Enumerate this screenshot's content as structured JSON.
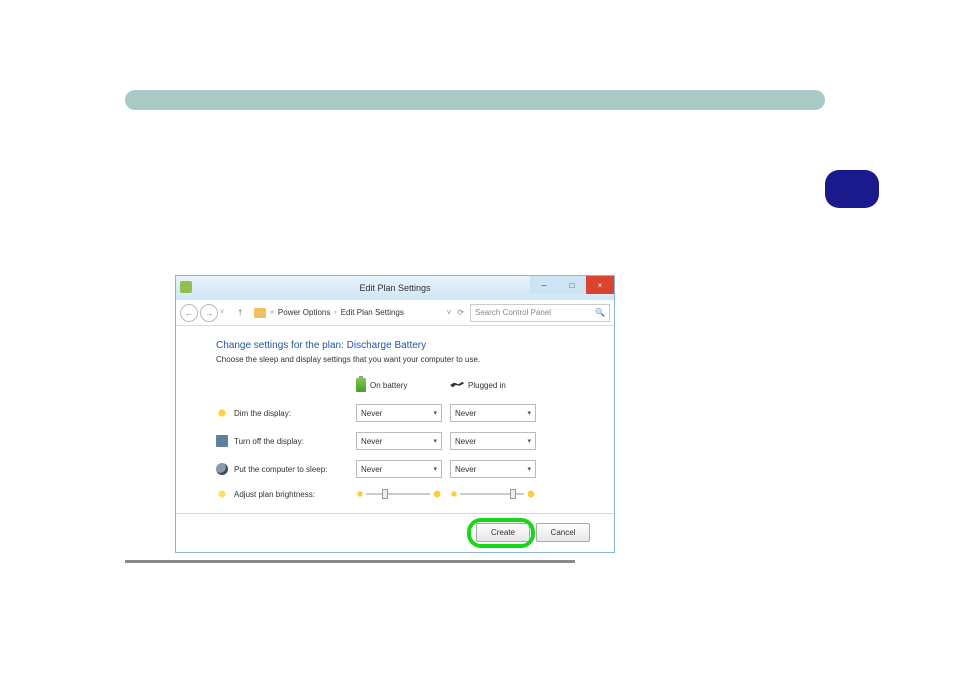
{
  "document": {
    "section_header": "",
    "step_label": ""
  },
  "window": {
    "title": "Edit Plan Settings",
    "controls": {
      "minimize": "–",
      "maximize": "□",
      "close": "×"
    }
  },
  "address_bar": {
    "back": "←",
    "forward": "→",
    "up": "↑",
    "breadcrumb_prefix": "«",
    "breadcrumb_1": "Power Options",
    "breadcrumb_sep": "›",
    "breadcrumb_2": "Edit Plan Settings",
    "refresh": "⟳",
    "dropdown": "˅",
    "search_placeholder": "Search Control Panel"
  },
  "content": {
    "plan_title": "Change settings for the plan: Discharge Battery",
    "plan_desc": "Choose the sleep and display settings that you want your computer to use.",
    "col_battery": "On battery",
    "col_plugged": "Plugged in",
    "rows": {
      "dim": "Dim the display:",
      "turnoff": "Turn off the display:",
      "sleep": "Put the computer to sleep:",
      "brightness": "Adjust plan brightness:"
    },
    "never": "Never"
  },
  "footer": {
    "create": "Create",
    "cancel": "Cancel"
  }
}
